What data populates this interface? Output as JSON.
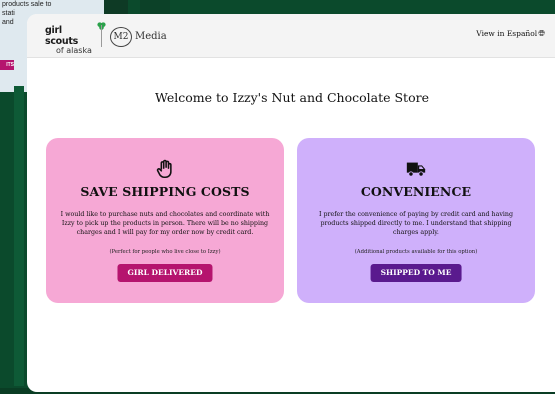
{
  "background": {
    "snippet_lines": [
      "products sale to",
      "stati",
      "and"
    ],
    "button_label": "ITS"
  },
  "header": {
    "gs_logo_line1": "girl scouts",
    "gs_logo_line2": "of alaska",
    "m2_mark": "M2",
    "m2_label": "Media",
    "lang_link": "View in Español",
    "lang_icon": "globe-icon"
  },
  "welcome": "Welcome to Izzy's Nut and Chocolate Store",
  "cards": [
    {
      "icon": "hand-icon",
      "title": "SAVE SHIPPING COSTS",
      "description": "I would like to purchase nuts and chocolates and coordinate with Izzy to pick up the products in person. There will be no shipping charges and I will pay for my order now by credit card.",
      "note": "(Perfect for people who live close to Izzy)",
      "button": "GIRL DELIVERED",
      "color": "#f6a8d5",
      "button_color": "#b5146e"
    },
    {
      "icon": "truck-icon",
      "title": "CONVENIENCE",
      "description": "I prefer the convenience of paying by credit card and having products shipped directly to me. I understand that shipping charges apply.",
      "note": "(Additional products available for this option)",
      "button": "SHIPPED TO ME",
      "color": "#cfb0fb",
      "button_color": "#5a1a8e"
    }
  ]
}
